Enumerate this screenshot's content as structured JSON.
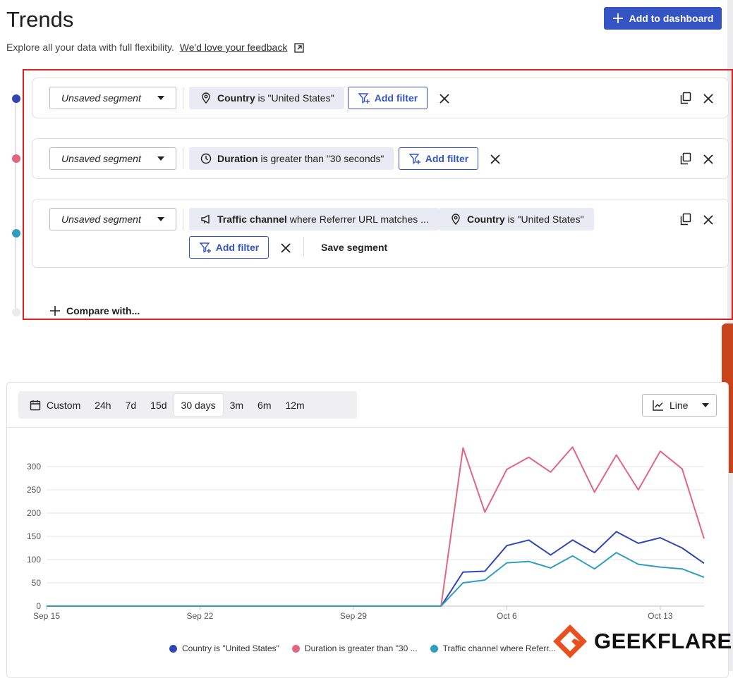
{
  "page": {
    "title": "Trends",
    "subtitle": "Explore all your data with full flexibility.",
    "feedback_link": "We'd love your feedback",
    "add_to_dashboard": "Add to dashboard"
  },
  "segments": [
    {
      "select_label": "Unsaved segment",
      "dot_color": "#2f46b4",
      "filters": [
        {
          "icon": "location-pin-icon",
          "field": "Country",
          "text": " is \"United States\""
        }
      ],
      "add_filter": "Add filter"
    },
    {
      "select_label": "Unsaved segment",
      "dot_color": "#e0677f",
      "filters": [
        {
          "icon": "clock-icon",
          "field": "Duration",
          "text": " is greater than \"30 seconds\""
        }
      ],
      "add_filter": "Add filter"
    },
    {
      "select_label": "Unsaved segment",
      "dot_color": "#2f9ebd",
      "filters": [
        {
          "icon": "megaphone-icon",
          "field": "Traffic channel",
          "text": " where Referrer URL matches ..."
        },
        {
          "icon": "location-pin-icon",
          "field": "Country",
          "text": " is \"United States\""
        }
      ],
      "add_filter": "Add filter",
      "save_segment": "Save segment"
    }
  ],
  "compare_with": "Compare with...",
  "date_ranges": {
    "custom": "Custom",
    "items": [
      "24h",
      "7d",
      "15d",
      "30 days",
      "3m",
      "6m",
      "12m"
    ],
    "selected": "30 days"
  },
  "chart_type_select": "Line",
  "chart_data": {
    "type": "line",
    "x": [
      "Sep 15",
      "Sep 16",
      "Sep 17",
      "Sep 18",
      "Sep 19",
      "Sep 20",
      "Sep 21",
      "Sep 22",
      "Sep 23",
      "Sep 24",
      "Sep 25",
      "Sep 26",
      "Sep 27",
      "Sep 28",
      "Sep 29",
      "Sep 30",
      "Oct 1",
      "Oct 2",
      "Oct 3",
      "Oct 4",
      "Oct 5",
      "Oct 6",
      "Oct 7",
      "Oct 8",
      "Oct 9",
      "Oct 10",
      "Oct 11",
      "Oct 12",
      "Oct 13",
      "Oct 14",
      "Oct 15"
    ],
    "x_tick_labels": [
      "Sep 15",
      "Sep 22",
      "Sep 29",
      "Oct 6",
      "Oct 13"
    ],
    "y_ticks": [
      0,
      50,
      100,
      150,
      200,
      250,
      300
    ],
    "ylim": [
      0,
      340
    ],
    "grid": true,
    "legend_position": "bottom",
    "series": [
      {
        "name": "Country is \"United States\"",
        "color": "#2f46b4",
        "values": [
          0,
          0,
          0,
          0,
          0,
          0,
          0,
          0,
          0,
          0,
          0,
          0,
          0,
          0,
          0,
          0,
          0,
          0,
          0,
          73,
          75,
          130,
          142,
          110,
          142,
          115,
          160,
          135,
          147,
          125,
          92
        ]
      },
      {
        "name": "Duration is greater than \"30 ...",
        "color": "#e0677f",
        "values": [
          0,
          0,
          0,
          0,
          0,
          0,
          0,
          0,
          0,
          0,
          0,
          0,
          0,
          0,
          0,
          0,
          0,
          0,
          0,
          340,
          202,
          294,
          320,
          288,
          342,
          245,
          325,
          250,
          333,
          295,
          145
        ]
      },
      {
        "name": "Traffic channel where Referr...",
        "color": "#2f9ebd",
        "values": [
          0,
          0,
          0,
          0,
          0,
          0,
          0,
          0,
          0,
          0,
          0,
          0,
          0,
          0,
          0,
          0,
          0,
          0,
          0,
          50,
          56,
          93,
          96,
          82,
          108,
          80,
          115,
          90,
          84,
          80,
          62
        ]
      }
    ]
  },
  "brand": {
    "name": "GEEKFLARE",
    "accent": "#e8501f"
  }
}
